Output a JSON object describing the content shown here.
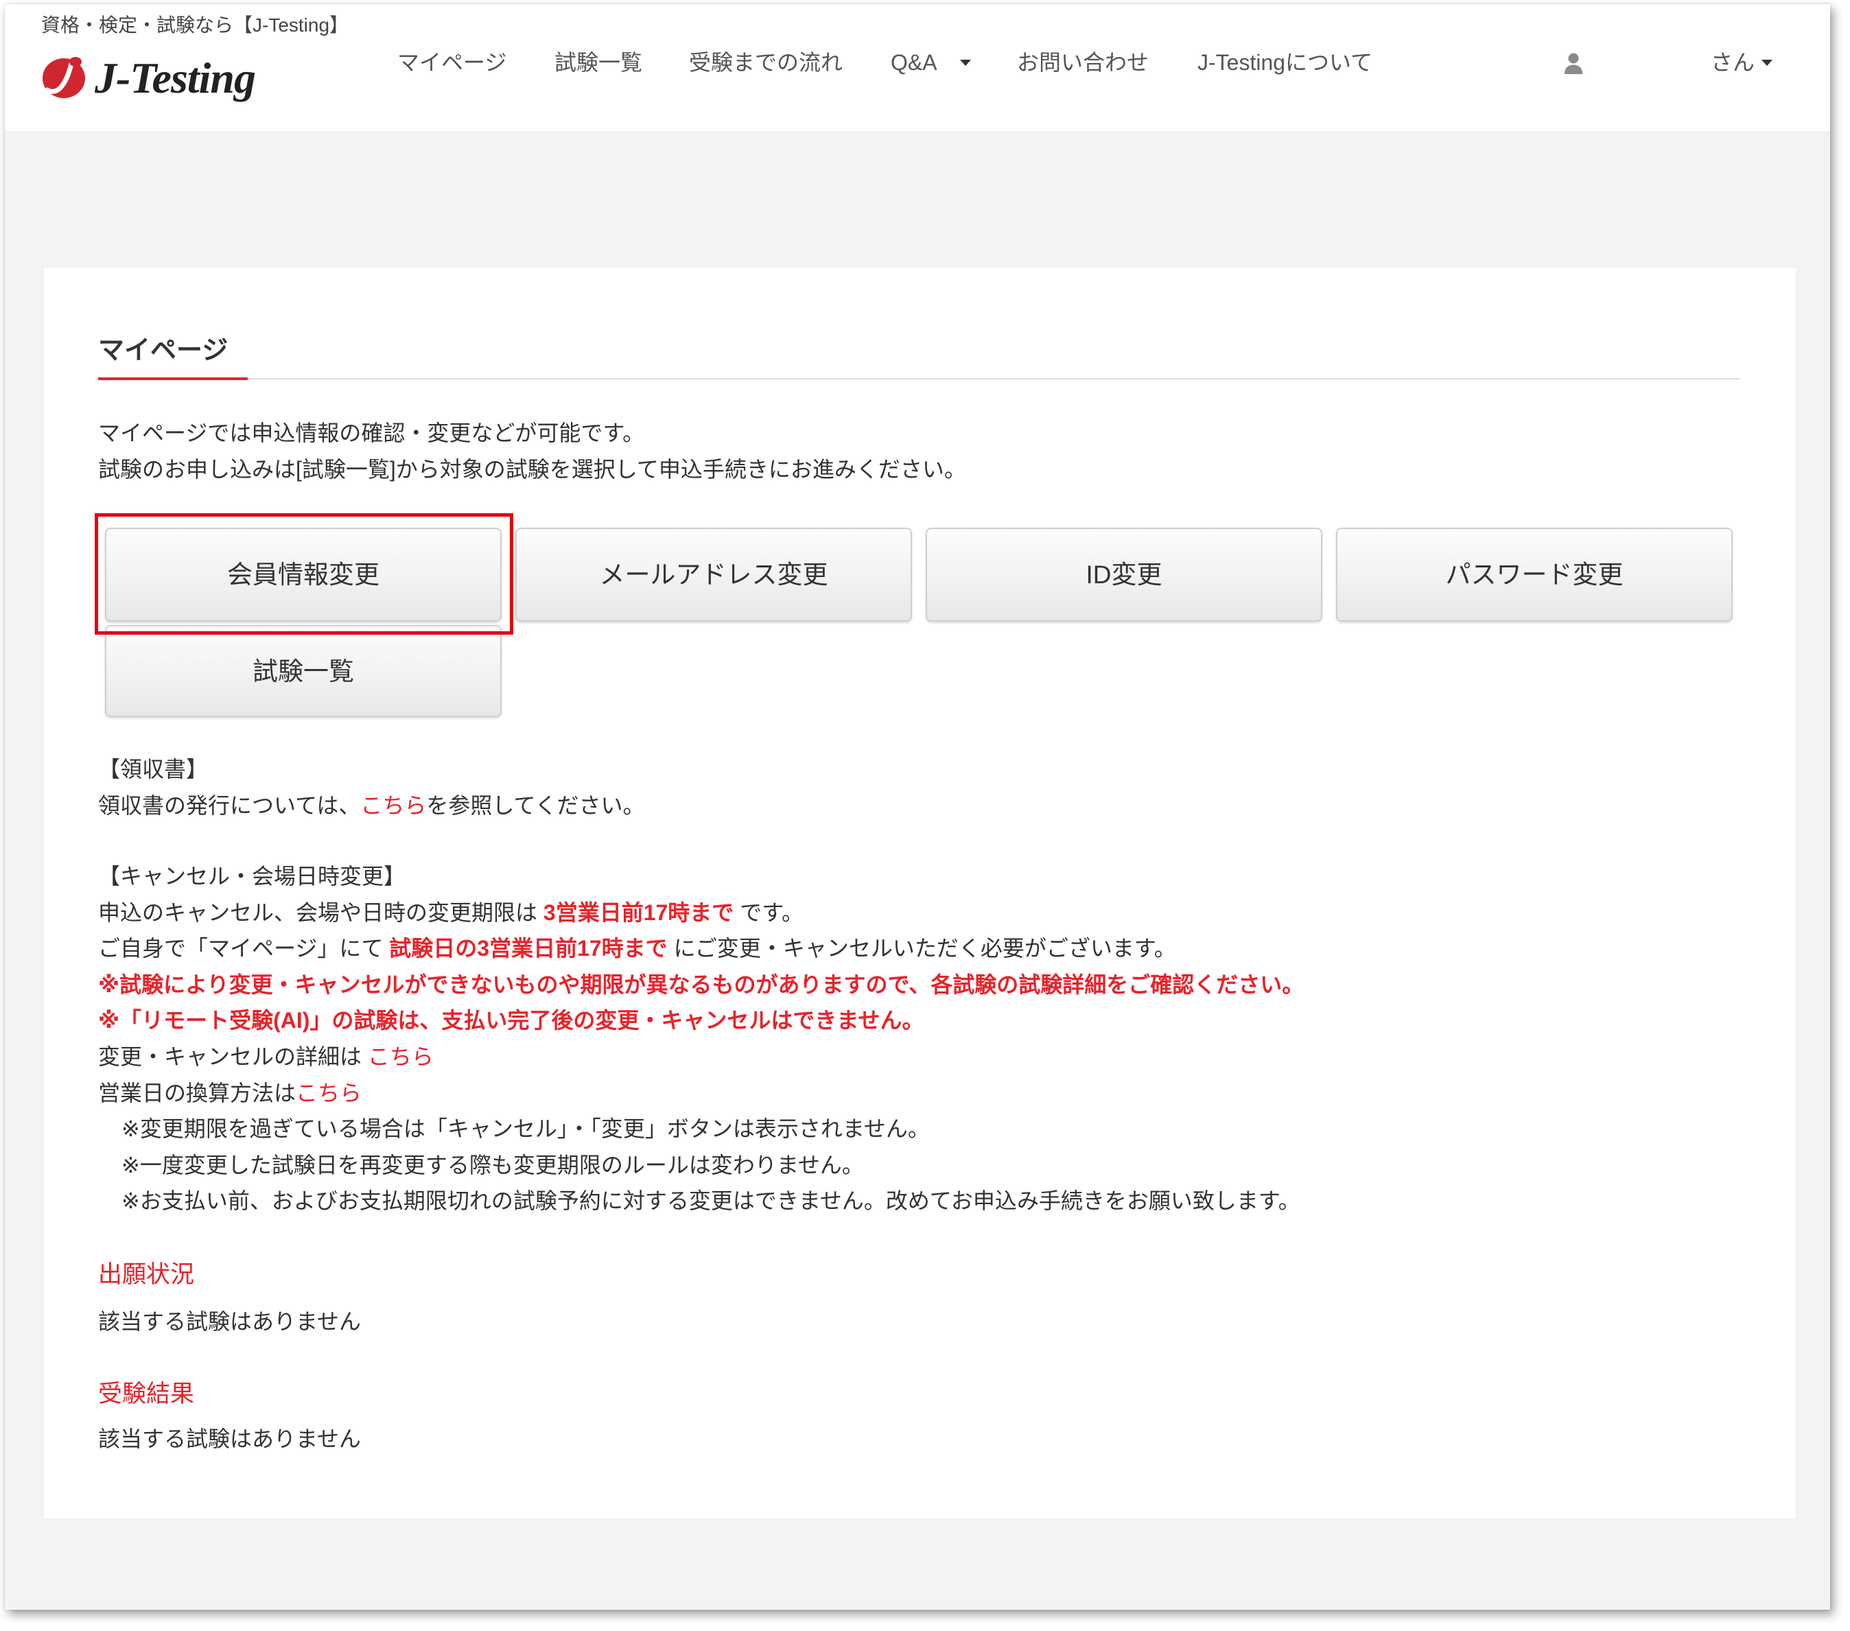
{
  "colors": {
    "accent": "#e8232a",
    "annotation": "#e50012",
    "text": "#333333",
    "nav_text": "#555555",
    "page_bg": "#f4f3f1",
    "logo": "#cf2630"
  },
  "header": {
    "tagline": "資格・検定・試験なら【J-Testing】",
    "logo_icon": "j-testing-logo-mark",
    "logo_text": "J-Testing",
    "nav": [
      {
        "label": "マイページ"
      },
      {
        "label": "試験一覧"
      },
      {
        "label": "受験までの流れ"
      },
      {
        "label": "Q&A",
        "icon": "caret-down-icon"
      },
      {
        "label": "お問い合わせ"
      },
      {
        "label": "J-Testingについて"
      }
    ],
    "user": {
      "icon": "user-icon",
      "label": "さん",
      "caret_icon": "caret-down-icon"
    }
  },
  "main": {
    "title": "マイページ",
    "intro": [
      "マイページでは申込情報の確認・変更などが可能です。",
      "試験のお申し込みは[試験一覧]から対象の試験を選択して申込手続きにお進みください。"
    ],
    "buttons": [
      "会員情報変更",
      "メールアドレス変更",
      "ID変更",
      "パスワード変更",
      "試験一覧"
    ],
    "receipt": {
      "heading": "【領収書】",
      "text_before": "領収書の発行については、",
      "link": "こちら",
      "text_after": "を参照してください。"
    },
    "cancel": {
      "heading": "【キャンセル・会場日時変更】",
      "deadline": {
        "before": "申込のキャンセル、会場や日時の変更期限は ",
        "emphasis": "3営業日前17時まで",
        "after": " です。"
      },
      "self_service": {
        "before": "ご自身で「マイページ」にて ",
        "emphasis": "試験日の3営業日前17時まで",
        "after": " にご変更・キャンセルいただく必要がございます。"
      },
      "warnings": [
        "※試験により変更・キャンセルができないものや期限が異なるものがありますので、各試験の試験詳細をご確認ください。",
        "※「リモート受験(AI)」の試験は、支払い完了後の変更・キャンセルはできません。"
      ],
      "details": {
        "before": "変更・キャンセルの詳細は ",
        "link": "こちら"
      },
      "business_days": {
        "before": "営業日の換算方法は",
        "link": "こちら"
      },
      "notes": [
        "※変更期限を過ぎている場合は「キャンセル」・「変更」ボタンは表示されません。",
        "※一度変更した試験日を再変更する際も変更期限のルールは変わりません。",
        "※お支払い前、およびお支払期限切れの試験予約に対する変更はできません。改めてお申込み手続きをお願い致します。"
      ]
    },
    "application_status": {
      "heading": "出願状況",
      "empty": "該当する試験はありません"
    },
    "results": {
      "heading": "受験結果",
      "empty": "該当する試験はありません"
    }
  }
}
